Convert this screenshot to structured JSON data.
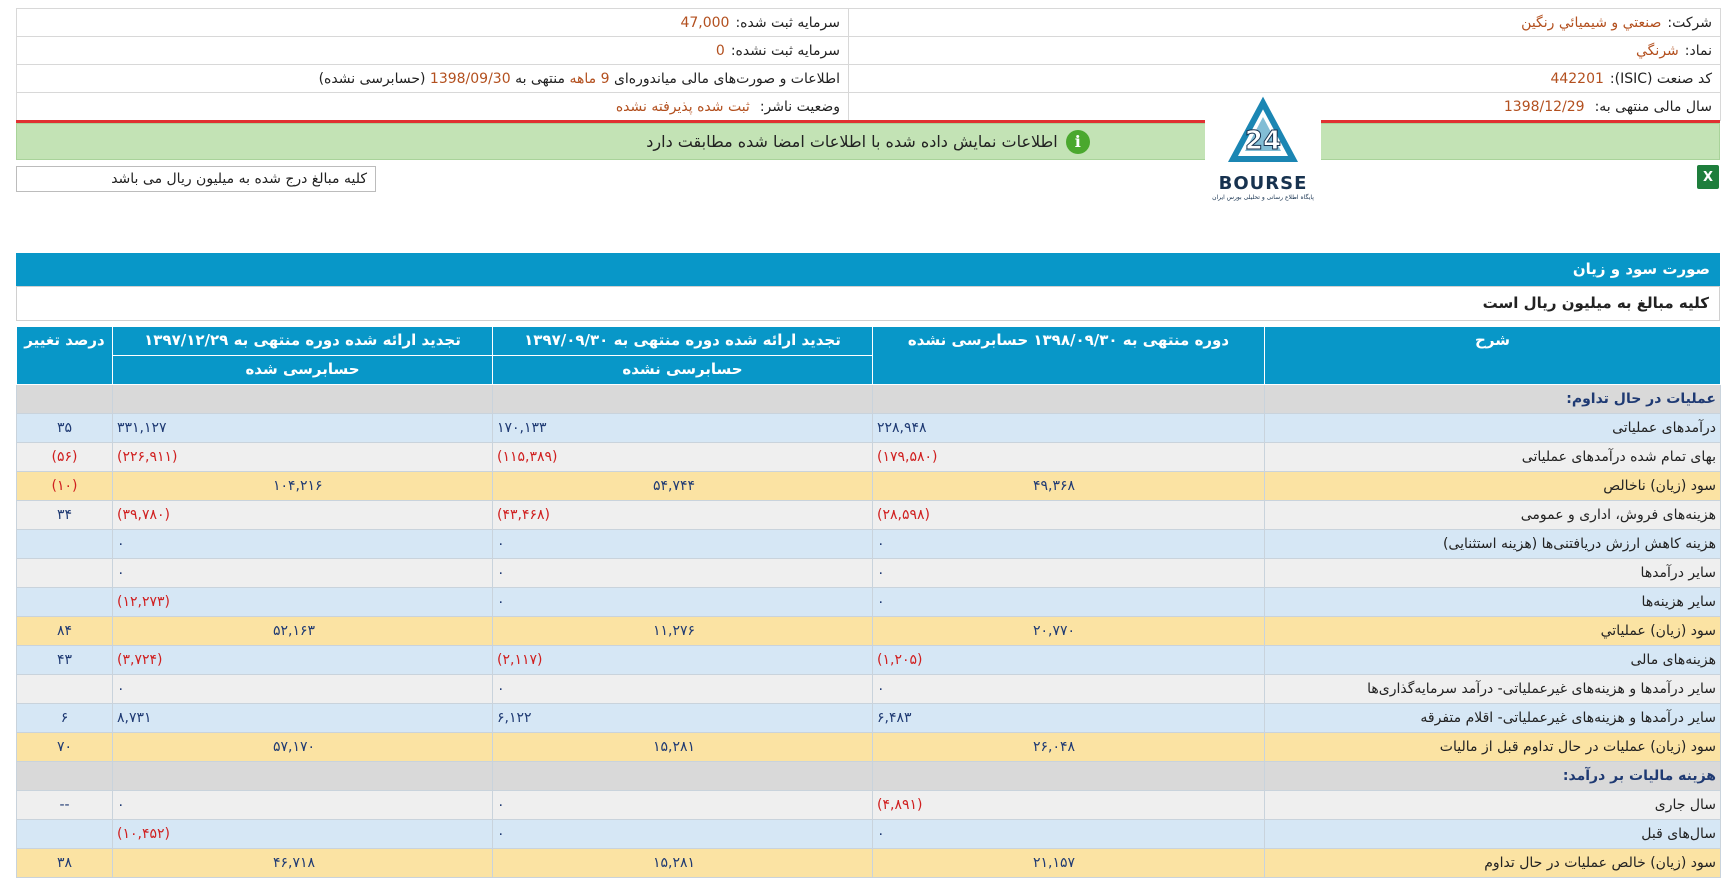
{
  "info": {
    "company_label": "شرکت:",
    "company_value": "صنعتي و شيميائي رنگين",
    "symbol_label": "نماد:",
    "symbol_value": "شرنگي",
    "isic_label": "کد صنعت (ISIC):",
    "isic_value": "442201",
    "fiscal_label": "سال مالی منتهی به:",
    "fiscal_value": "1398/12/29",
    "reg_cap_label": "سرمایه ثبت شده:",
    "reg_cap_value": "47,000",
    "unreg_cap_label": "سرمایه ثبت نشده:",
    "unreg_cap_value": "0",
    "report_pre": "اطلاعات و صورت‌های مالی میاندوره‌ای",
    "report_period": "9 ماهه",
    "report_mid": "منتهی به",
    "report_date": "1398/09/30",
    "report_post": "(حسابرسی نشده)",
    "status_label": "وضعیت ناشر:",
    "status_value": "ثبت شده پذیرفته نشده"
  },
  "notice": {
    "text": "اطلاعات نمایش داده شده با اطلاعات امضا شده مطابقت دارد",
    "icon": "info-icon",
    "color": "#c3e3b5"
  },
  "logo": {
    "text": "BOURSE",
    "caption": "پایگاه اطلاع رسانی و تحلیلی بورس ایران"
  },
  "unit_note": "کلیه مبالغ درج شده به میلیون ریال می باشد",
  "section": {
    "title": "صورت سود و زیان",
    "subtitle": "کلیه مبالغ به میلیون ریال است"
  },
  "columns": {
    "desc": "شرح",
    "c1": "دوره منتهی به ۱۳۹۸/۰۹/۳۰ حسابرسی نشده",
    "c2": "تجدید ارائه شده دوره منتهی به ۱۳۹۷/۰۹/۳۰",
    "c2_sub": "حسابرسی نشده",
    "c3": "تجدید ارائه شده دوره منتهی به ۱۳۹۷/۱۲/۲۹",
    "c3_sub": "حسابرسی شده",
    "c4": "درصد تغییر"
  },
  "rows": [
    {
      "type": "head",
      "label": "عملیات در حال تداوم:",
      "v1": "",
      "v2": "",
      "v3": "",
      "v4": ""
    },
    {
      "type": "blue",
      "label": "درآمدهای عملیاتی",
      "v1": "۲۲۸,۹۴۸",
      "v2": "۱۷۰,۱۳۳",
      "v3": "۳۳۱,۱۲۷",
      "v4": "۳۵"
    },
    {
      "type": "grey",
      "label": "بهای تمام شده درآمدهای عملیاتی",
      "v1": "(۱۷۹,۵۸۰)",
      "v2": "(۱۱۵,۳۸۹)",
      "v3": "(۲۲۶,۹۱۱)",
      "v4": "(۵۶)"
    },
    {
      "type": "yel",
      "label": "سود (زیان) ناخالص",
      "v1": "۴۹,۳۶۸",
      "v2": "۵۴,۷۴۴",
      "v3": "۱۰۴,۲۱۶",
      "v4": "(۱۰)",
      "shift": true
    },
    {
      "type": "grey",
      "label": "هزینه‌های فروش، اداری و عمومی",
      "v1": "(۲۸,۵۹۸)",
      "v2": "(۴۳,۴۶۸)",
      "v3": "(۳۹,۷۸۰)",
      "v4": "۳۴"
    },
    {
      "type": "blue",
      "label": "هزینه کاهش ارزش دریافتنی‌ها (هزینه استثنایی)",
      "v1": "۰",
      "v2": "۰",
      "v3": "۰",
      "v4": ""
    },
    {
      "type": "grey",
      "label": "سایر درآمدها",
      "v1": "۰",
      "v2": "۰",
      "v3": "۰",
      "v4": ""
    },
    {
      "type": "blue",
      "label": "سایر هزینه‌ها",
      "v1": "۰",
      "v2": "۰",
      "v3": "(۱۲,۲۷۳)",
      "v4": ""
    },
    {
      "type": "yel",
      "label": "سود (زیان) عملیاتي",
      "v1": "۲۰,۷۷۰",
      "v2": "۱۱,۲۷۶",
      "v3": "۵۲,۱۶۳",
      "v4": "۸۴",
      "shift": true
    },
    {
      "type": "blue",
      "label": "هزینه‌های مالی",
      "v1": "(۱,۲۰۵)",
      "v2": "(۲,۱۱۷)",
      "v3": "(۳,۷۲۴)",
      "v4": "۴۳"
    },
    {
      "type": "grey",
      "label": "سایر درآمدها و هزینه‌های غیرعملیاتی- درآمد سرمایه‌گذاری‌ها",
      "v1": "۰",
      "v2": "۰",
      "v3": "۰",
      "v4": ""
    },
    {
      "type": "blue",
      "label": "سایر درآمدها و هزینه‌های غیرعملیاتی- اقلام متفرقه",
      "v1": "۶,۴۸۳",
      "v2": "۶,۱۲۲",
      "v3": "۸,۷۳۱",
      "v4": "۶"
    },
    {
      "type": "yel",
      "label": "سود (زیان) عملیات در حال تداوم قبل از مالیات",
      "v1": "۲۶,۰۴۸",
      "v2": "۱۵,۲۸۱",
      "v3": "۵۷,۱۷۰",
      "v4": "۷۰",
      "shift": true
    },
    {
      "type": "head",
      "label": "هزینه مالیات بر درآمد:",
      "v1": "",
      "v2": "",
      "v3": "",
      "v4": ""
    },
    {
      "type": "grey",
      "label": "سال جاری",
      "v1": "(۴,۸۹۱)",
      "v2": "۰",
      "v3": "۰",
      "v4": "--"
    },
    {
      "type": "blue",
      "label": "سال‌های قبل",
      "v1": "۰",
      "v2": "۰",
      "v3": "(۱۰,۴۵۲)",
      "v4": ""
    },
    {
      "type": "yel",
      "label": "سود (زیان) خالص عملیات در حال تداوم",
      "v1": "۲۱,۱۵۷",
      "v2": "۱۵,۲۸۱",
      "v3": "۴۶,۷۱۸",
      "v4": "۳۸",
      "shift": true
    }
  ]
}
